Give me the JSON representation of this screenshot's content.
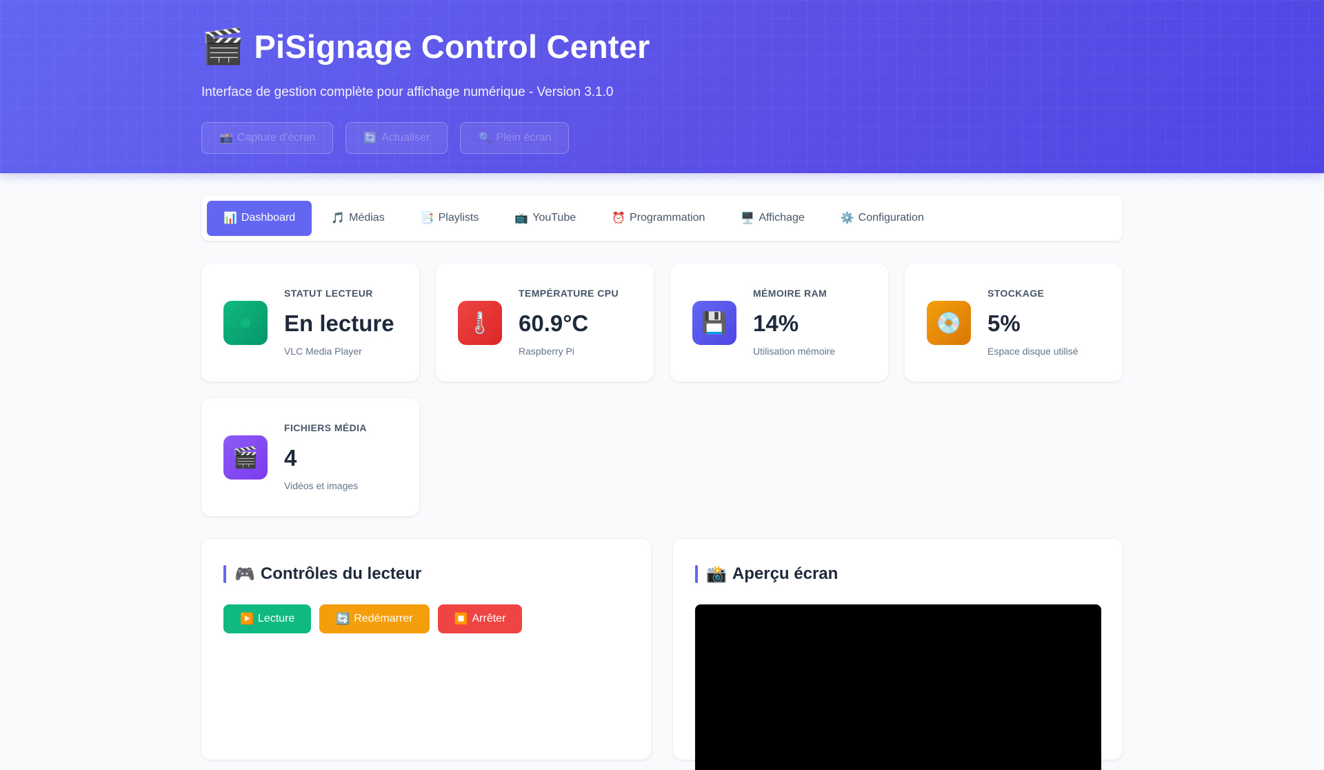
{
  "header": {
    "title": "PiSignage Control Center",
    "title_icon": "🎬",
    "subtitle": "Interface de gestion complète pour affichage numérique - Version 3.1.0",
    "actions": [
      {
        "icon": "📸",
        "label": "Capture d'écran"
      },
      {
        "icon": "🔄",
        "label": "Actualiser"
      },
      {
        "icon": "🔍",
        "label": "Plein écran"
      }
    ]
  },
  "tabs": [
    {
      "icon": "📊",
      "label": "Dashboard",
      "active": true
    },
    {
      "icon": "🎵",
      "label": "Médias"
    },
    {
      "icon": "📑",
      "label": "Playlists"
    },
    {
      "icon": "📺",
      "label": "YouTube"
    },
    {
      "icon": "⏰",
      "label": "Programmation"
    },
    {
      "icon": "🖥️",
      "label": "Affichage"
    },
    {
      "icon": "⚙️",
      "label": "Configuration"
    }
  ],
  "stats": {
    "player": {
      "label": "STATUT LECTEUR",
      "value": "En lecture",
      "desc": "VLC Media Player",
      "color": "#10b981"
    },
    "cpu": {
      "label": "TEMPÉRATURE CPU",
      "value": "60.9°C",
      "desc": "Raspberry Pi",
      "icon": "🌡️",
      "color": "#ef4444"
    },
    "ram": {
      "label": "MÉMOIRE RAM",
      "value": "14%",
      "desc": "Utilisation mémoire",
      "icon": "💾",
      "color": "#6366f1"
    },
    "storage": {
      "label": "STOCKAGE",
      "value": "5%",
      "desc": "Espace disque utilisé",
      "icon": "💿",
      "color": "#f59e0b"
    },
    "media": {
      "label": "FICHIERS MÉDIA",
      "value": "4",
      "desc": "Vidéos et images",
      "icon": "🎬",
      "color": "#8b5cf6"
    }
  },
  "controls": {
    "title": "Contrôles du lecteur",
    "title_icon": "🎮",
    "buttons": [
      {
        "icon": "▶️",
        "label": "Lecture",
        "color": "#10b981"
      },
      {
        "icon": "🔄",
        "label": "Redémarrer",
        "color": "#f59e0b"
      },
      {
        "icon": "⏹️",
        "label": "Arrêter",
        "color": "#ef4444"
      }
    ]
  },
  "preview": {
    "title": "Aperçu écran",
    "title_icon": "📸"
  }
}
